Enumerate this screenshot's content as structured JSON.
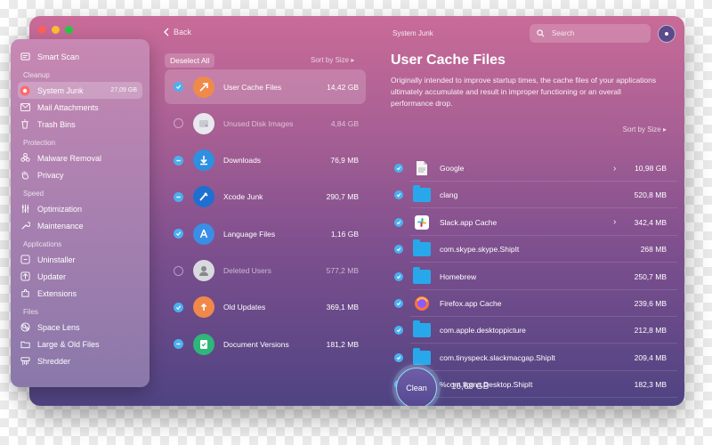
{
  "header": {
    "back_label": "Back",
    "title": "System Junk",
    "search_placeholder": "Search"
  },
  "sidebar": {
    "smart_scan": "Smart Scan",
    "sections": {
      "cleanup": "Cleanup",
      "protection": "Protection",
      "speed": "Speed",
      "applications": "Applications",
      "files": "Files"
    },
    "items": {
      "system_junk": {
        "label": "System Junk",
        "size": "27,09 GB"
      },
      "mail_attachments": "Mail Attachments",
      "trash_bins": "Trash Bins",
      "malware_removal": "Malware Removal",
      "privacy": "Privacy",
      "optimization": "Optimization",
      "maintenance": "Maintenance",
      "uninstaller": "Uninstaller",
      "updater": "Updater",
      "extensions": "Extensions",
      "space_lens": "Space Lens",
      "large_old_files": "Large & Old Files",
      "shredder": "Shredder"
    }
  },
  "middle": {
    "deselect_label": "Deselect All",
    "sort_label": "Sort by Size ▸",
    "categories": [
      {
        "name": "User Cache Files",
        "size": "14,42 GB",
        "state": "on"
      },
      {
        "name": "Unused Disk Images",
        "size": "4,84 GB",
        "state": "off"
      },
      {
        "name": "Downloads",
        "size": "76,9 MB",
        "state": "part"
      },
      {
        "name": "Xcode Junk",
        "size": "290,7 MB",
        "state": "part"
      },
      {
        "name": "Language Files",
        "size": "1,16 GB",
        "state": "on"
      },
      {
        "name": "Deleted Users",
        "size": "577,2 MB",
        "state": "off"
      },
      {
        "name": "Old Updates",
        "size": "369,1 MB",
        "state": "on"
      },
      {
        "name": "Document Versions",
        "size": "181,2 MB",
        "state": "part"
      }
    ]
  },
  "detail": {
    "title": "User Cache Files",
    "description": "Originally intended to improve startup times, the cache files of your applications ultimately accumulate and result in improper functioning or an overall performance drop.",
    "sort_label": "Sort by Size ▸",
    "files": [
      {
        "name": "Google",
        "size": "10,98 GB",
        "icon": "document-icon",
        "expand": true
      },
      {
        "name": "clang",
        "size": "520,8 MB",
        "icon": "folder-icon",
        "expand": false
      },
      {
        "name": "Slack.app Cache",
        "size": "342,4 MB",
        "icon": "slack-icon",
        "expand": true
      },
      {
        "name": "com.skype.skype.ShipIt",
        "size": "268 MB",
        "icon": "folder-icon",
        "expand": false
      },
      {
        "name": "Homebrew",
        "size": "250,7 MB",
        "icon": "folder-icon",
        "expand": false
      },
      {
        "name": "Firefox.app Cache",
        "size": "239,6 MB",
        "icon": "firefox-icon",
        "expand": false
      },
      {
        "name": "com.apple.desktoppicture",
        "size": "212,8 MB",
        "icon": "folder-icon",
        "expand": false
      },
      {
        "name": "com.tinyspeck.slackmacgap.ShipIt",
        "size": "209,4 MB",
        "icon": "folder-icon",
        "expand": false
      },
      {
        "name": "%com.figma.Desktop.ShipIt",
        "size": "182,3 MB",
        "icon": "folder-icon",
        "expand": false
      }
    ]
  },
  "footer": {
    "clean_label": "Clean",
    "total_size": "16,69 GB"
  },
  "colors": {
    "accent_blue": "#4bb0f0",
    "folder_blue": "#28a8ea"
  }
}
